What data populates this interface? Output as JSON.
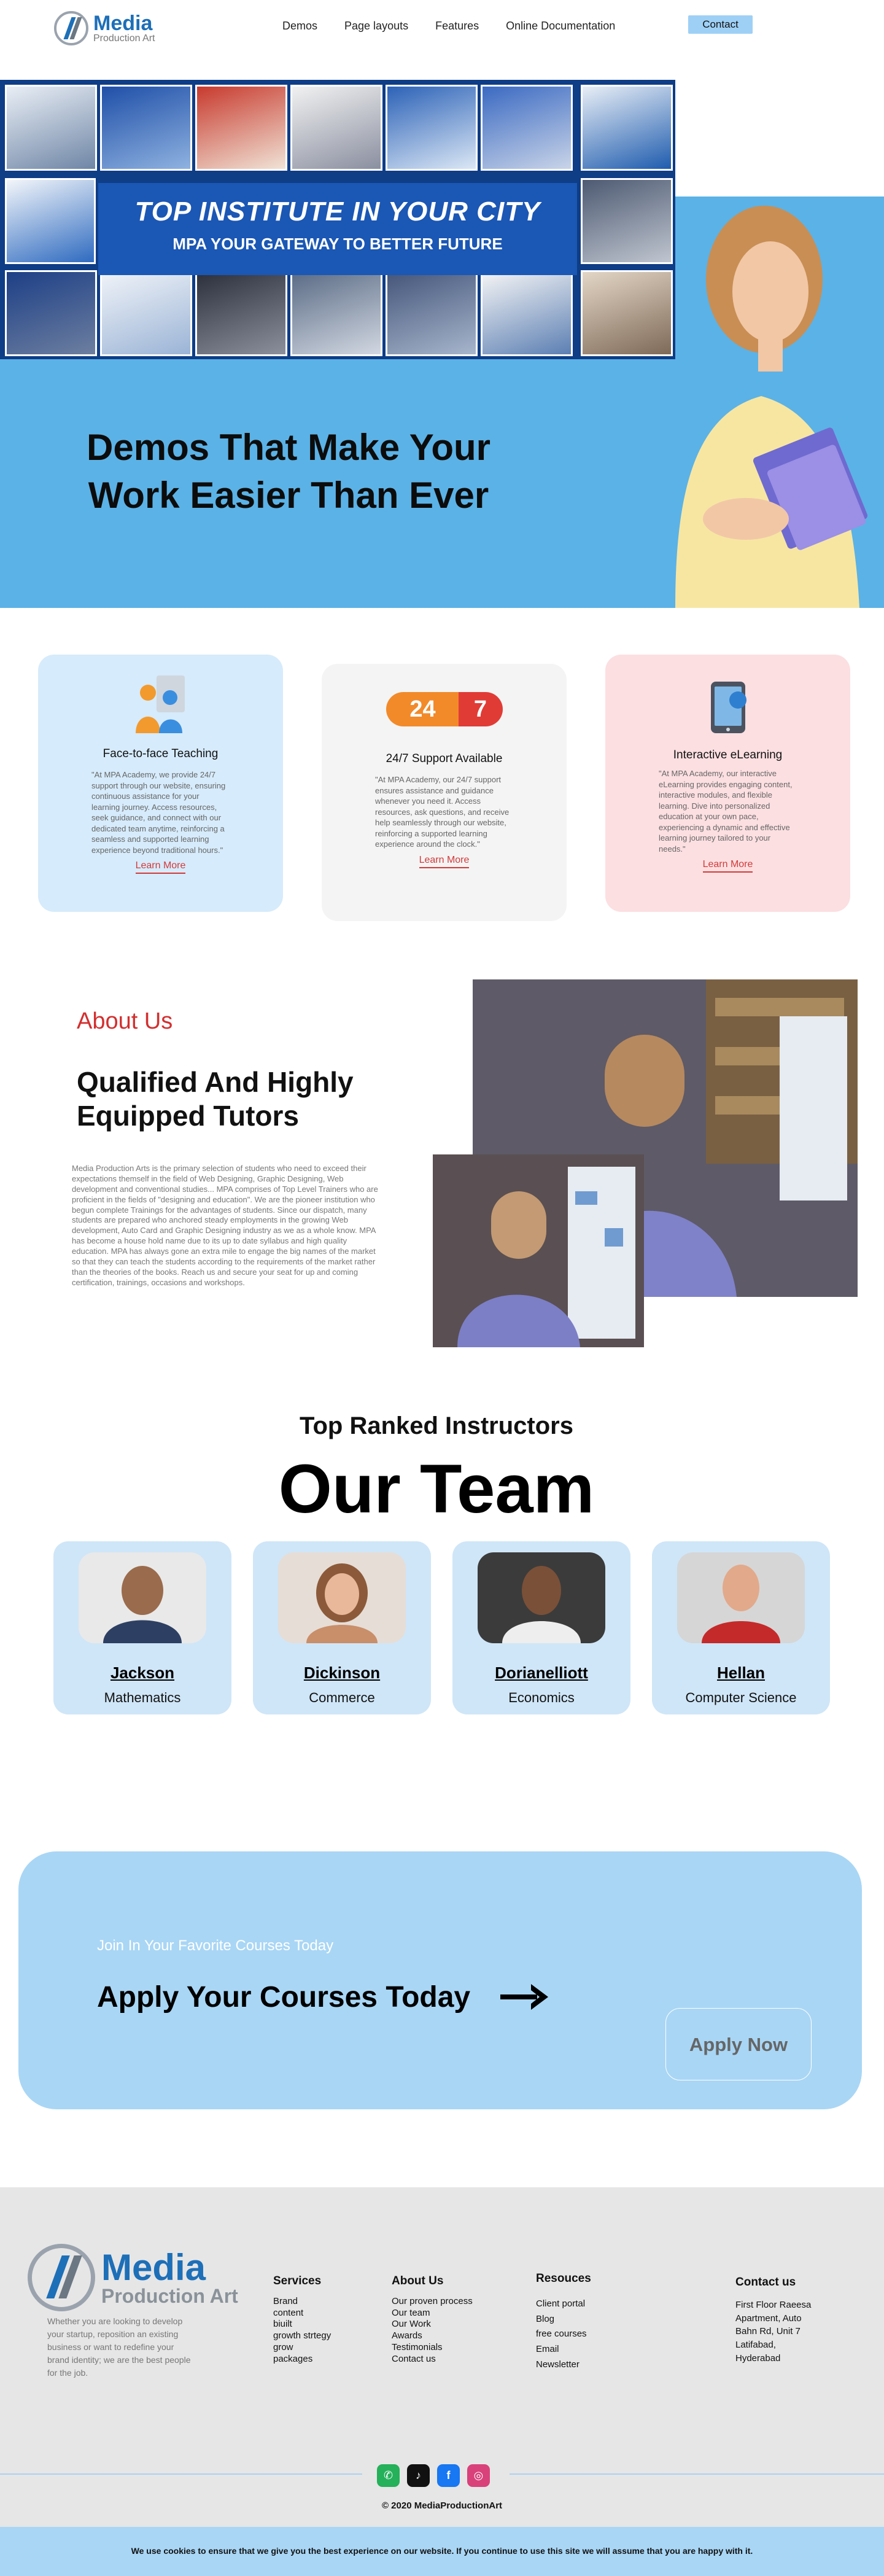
{
  "nav": {
    "logo_main": "Media",
    "logo_sub": "Production Art",
    "menu": [
      "Demos",
      "Page layouts",
      "Features",
      "Online Documentation"
    ],
    "contact": "Contact"
  },
  "hero": {
    "banner_title": "TOP INSTITUTE IN YOUR CITY",
    "banner_sub": "MPA YOUR GATEWAY TO BETTER FUTURE",
    "heading_line1": "Demos That Make Your",
    "heading_line2": "Work Easier Than Ever"
  },
  "features": [
    {
      "title": "Face-to-face Teaching",
      "desc": "\"At MPA Academy, we provide 24/7 support through our website, ensuring continuous assistance for your learning journey. Access resources, seek guidance, and connect with our dedicated team anytime, reinforcing a seamless and supported learning experience beyond traditional hours.\"",
      "link": "Learn More",
      "icon": "people-icon",
      "bg": "#d6ebfb"
    },
    {
      "title": "24/7 Support Available",
      "desc": "\"At MPA Academy, our 24/7 support ensures assistance and guidance whenever you need it. Access resources, ask questions, and receive help seamlessly through our website, reinforcing a supported learning experience around the clock.\"",
      "link": "Learn More",
      "icon_text_a": "24",
      "icon_text_b": "7",
      "bg": "#f5f4f4"
    },
    {
      "title": "Interactive eLearning",
      "desc": "\"At MPA Academy, our interactive eLearning provides engaging content, interactive modules, and flexible learning. Dive into personalized education at your own pace, experiencing a dynamic and effective learning journey tailored to your needs.\"",
      "link": "Learn More",
      "icon": "tablet-icon",
      "bg": "#fcdfe1"
    }
  ],
  "about": {
    "label": "About Us",
    "heading": "Qualified And Highly Equipped Tutors",
    "text": "Media Production Arts is the primary selection of students who need to exceed their expectations themself in the field of Web Designing, Graphic Designing, Web development and conventional studies... MPA comprises of Top Level Trainers who are proficient in the fields of \"designing and education\". We are the pioneer institution who begun complete Trainings for the advantages of students. Since our dispatch, many students are prepared who anchored steady employments in the growing Web development, Auto Card and Graphic Designing industry as we as a whole know. MPA has become a house hold name due to its up to date syllabus and high quality education. MPA has always gone an extra mile to engage the big names of the market so that they can teach the students according to the requirements of the market rather than the theories of the books. Reach us and secure your seat for up and coming certification, trainings, occasions and workshops."
  },
  "team": {
    "subtitle": "Top Ranked Instructors",
    "title": "Our Team",
    "members": [
      {
        "name": "Jackson",
        "role": "Mathematics"
      },
      {
        "name": "Dickinson",
        "role": "Commerce"
      },
      {
        "name": "Dorianelliott",
        "role": "Economics"
      },
      {
        "name": "Hellan",
        "role": "Computer Science"
      }
    ]
  },
  "cta": {
    "small": "Join In Your Favorite Courses Today",
    "big": "Apply Your Courses Today",
    "button": "Apply Now"
  },
  "footer": {
    "logo_main": "Media",
    "logo_sub": "Production Art",
    "desc": "Whether you are looking to develop your startup, reposition an existing business or want to redefine your brand identity; we are the best people for the job.",
    "services": {
      "title": "Services",
      "items": [
        "Brand",
        "content",
        "biuilt",
        "growth strtegy",
        "grow",
        "packages"
      ]
    },
    "about": {
      "title": "About Us",
      "items": [
        "Our proven process",
        "Our team",
        "Our Work",
        "Awards",
        "Testimonials",
        "Contact us"
      ]
    },
    "resources": {
      "title": "Resouces",
      "items": [
        "Client portal",
        "Blog",
        "free courses",
        "Email",
        "Newsletter"
      ]
    },
    "contact": {
      "title": "Contact us",
      "lines": [
        "First Floor Raeesa",
        "Apartment, Auto",
        "Bahn Rd, Unit 7",
        "Latifabad,",
        "Hyderabad"
      ]
    },
    "socials": [
      "whatsapp-icon",
      "tiktok-icon",
      "facebook-icon",
      "instagram-icon"
    ],
    "copyright": "© 2020 MediaProductionArt"
  },
  "cookie": {
    "text": "We use cookies to ensure that we give you the best experience on our website. If you continue to use this site we will assume that you are happy with it."
  }
}
